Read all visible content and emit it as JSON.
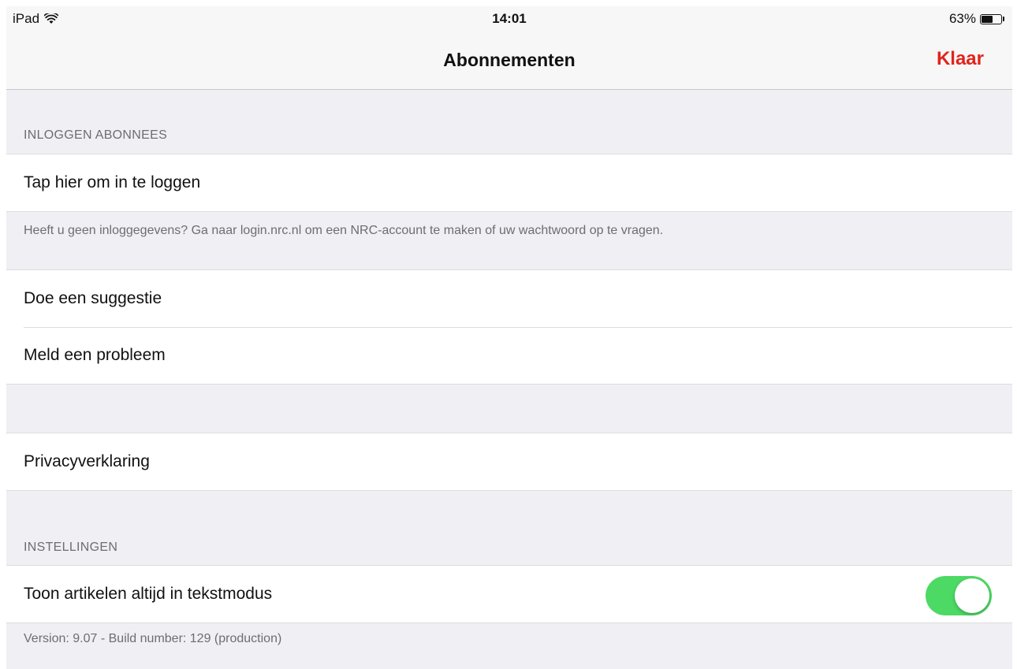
{
  "status_bar": {
    "device": "iPad",
    "time": "14:01",
    "battery_text": "63%",
    "battery_level": 0.63
  },
  "nav": {
    "title": "Abonnementen",
    "done_label": "Klaar",
    "done_color": "#e2231a"
  },
  "login_section": {
    "header": "INLOGGEN ABONNEES",
    "login_row": "Tap hier om in te loggen",
    "footer": "Heeft u geen inloggegevens? Ga naar login.nrc.nl om een NRC-account te maken of uw wachtwoord op te vragen."
  },
  "feedback_section": {
    "suggestion_row": "Doe een suggestie",
    "problem_row": "Meld een probleem"
  },
  "privacy_section": {
    "privacy_row": "Privacyverklaring"
  },
  "settings_section": {
    "header": "INSTELLINGEN",
    "text_mode_row": "Toon artikelen altijd in tekstmodus",
    "text_mode_enabled": true,
    "toggle_on_color": "#4cd964",
    "footer": "Version: 9.07 - Build number: 129 (production)"
  }
}
